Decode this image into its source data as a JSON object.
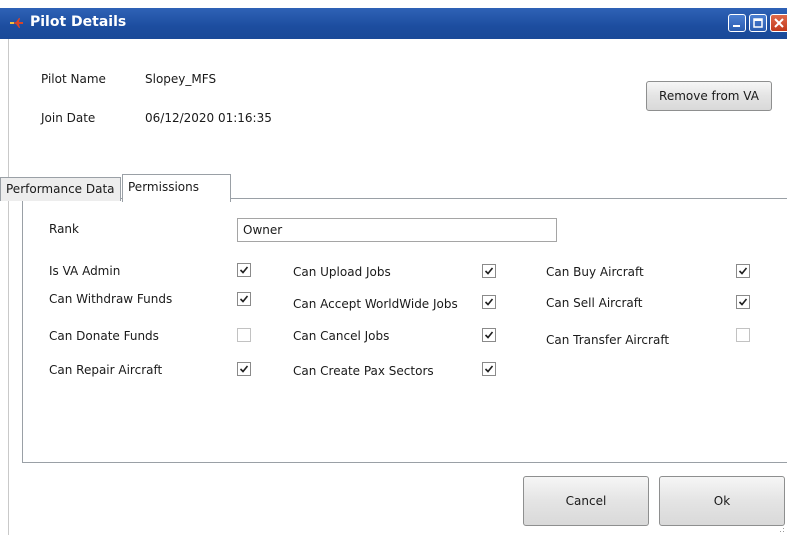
{
  "window": {
    "title": "Pilot Details",
    "icon": "aircraft-icon",
    "title_bar_color": "#2358ad"
  },
  "pilot": {
    "name_label": "Pilot Name",
    "name_value": "Slopey_MFS",
    "join_label": "Join Date",
    "join_value": "06/12/2020 01:16:35"
  },
  "actions": {
    "remove_label": "Remove from VA",
    "cancel_label": "Cancel",
    "ok_label": "Ok"
  },
  "tabs": [
    {
      "label": "Performance Data",
      "active": false
    },
    {
      "label": "Permissions",
      "active": true
    }
  ],
  "permissions": {
    "rank_label": "Rank",
    "rank_value": "Owner",
    "items": [
      {
        "label": "Is VA Admin",
        "checked": true
      },
      {
        "label": "Can Withdraw Funds",
        "checked": true
      },
      {
        "label": "Can Donate Funds",
        "checked": false
      },
      {
        "label": "Can Repair Aircraft",
        "checked": true
      },
      {
        "label": "Can Upload Jobs",
        "checked": true
      },
      {
        "label": "Can Accept WorldWide Jobs",
        "checked": true
      },
      {
        "label": "Can Cancel Jobs",
        "checked": true
      },
      {
        "label": "Can Create Pax Sectors",
        "checked": true
      },
      {
        "label": "Can Buy Aircraft",
        "checked": true
      },
      {
        "label": "Can Sell Aircraft",
        "checked": true
      },
      {
        "label": "Can Transfer Aircraft",
        "checked": false
      }
    ]
  }
}
